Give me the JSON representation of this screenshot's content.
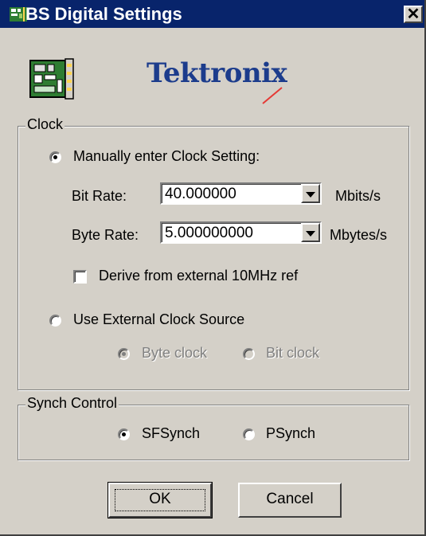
{
  "window": {
    "title": "BS Digital Settings",
    "close_label": "✕"
  },
  "logo": {
    "text": "Tektronix"
  },
  "clock": {
    "group_label": "Clock",
    "manual": {
      "label": "Manually enter Clock Setting:",
      "selected": true
    },
    "bit_rate": {
      "label": "Bit Rate:",
      "value": "40.000000",
      "unit": "Mbits/s"
    },
    "byte_rate": {
      "label": "Byte Rate:",
      "value": "5.000000000",
      "unit": "Mbytes/s"
    },
    "derive": {
      "label": "Derive from external 10MHz ref",
      "checked": false
    },
    "external": {
      "label": "Use External Clock Source",
      "selected": false
    },
    "byte_clock": {
      "label": "Byte clock",
      "selected": true,
      "enabled": false
    },
    "bit_clock": {
      "label": "Bit clock",
      "selected": false,
      "enabled": false
    }
  },
  "synch": {
    "group_label": "Synch Control",
    "sfsynch": {
      "label": "SFSynch",
      "selected": true
    },
    "psynch": {
      "label": "PSynch",
      "selected": false
    }
  },
  "buttons": {
    "ok": "OK",
    "cancel": "Cancel"
  },
  "colors": {
    "titlebar": "#08246b",
    "face": "#d4d0c8",
    "logo": "#1c3c8c"
  }
}
